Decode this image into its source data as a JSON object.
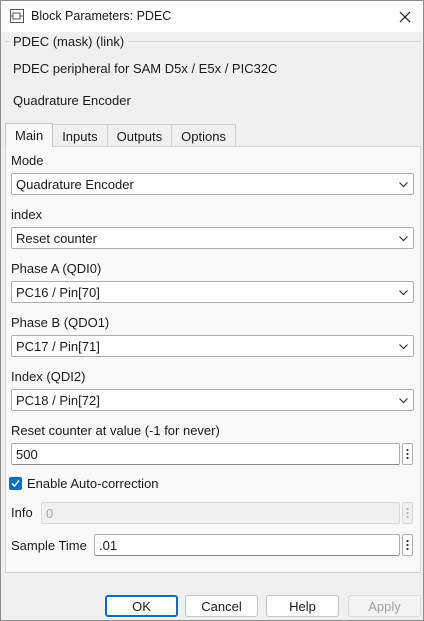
{
  "window": {
    "title": "Block Parameters: PDEC"
  },
  "mask": {
    "title": "PDEC (mask) (link)",
    "description_line1": "PDEC peripheral for SAM D5x / E5x / PIC32C",
    "description_line2": "Quadrature Encoder"
  },
  "tabs": [
    {
      "label": "Main",
      "active": true
    },
    {
      "label": "Inputs",
      "active": false
    },
    {
      "label": "Outputs",
      "active": false
    },
    {
      "label": "Options",
      "active": false
    }
  ],
  "main": {
    "mode": {
      "label": "Mode",
      "value": "Quadrature Encoder"
    },
    "index": {
      "label": "index",
      "value": "Reset counter"
    },
    "phase_a": {
      "label": "Phase A (QDI0)",
      "value": "PC16 / Pin[70]"
    },
    "phase_b": {
      "label": "Phase B (QDO1)",
      "value": "PC17 / Pin[71]"
    },
    "index_pin": {
      "label": "Index (QDI2)",
      "value": "PC18 / Pin[72]"
    },
    "reset_value": {
      "label": "Reset counter at value (-1 for never)",
      "value": "500"
    },
    "auto_correction": {
      "label": "Enable Auto-correction",
      "checked": true
    },
    "info": {
      "label": "Info",
      "value": "0"
    },
    "sample_time": {
      "label": "Sample Time",
      "value": ".01"
    }
  },
  "buttons": {
    "ok": "OK",
    "cancel": "Cancel",
    "help": "Help",
    "apply": "Apply"
  },
  "colors": {
    "accent": "#0f6cbd",
    "panel": "#f9f9f9",
    "background": "#f0f0f0"
  }
}
